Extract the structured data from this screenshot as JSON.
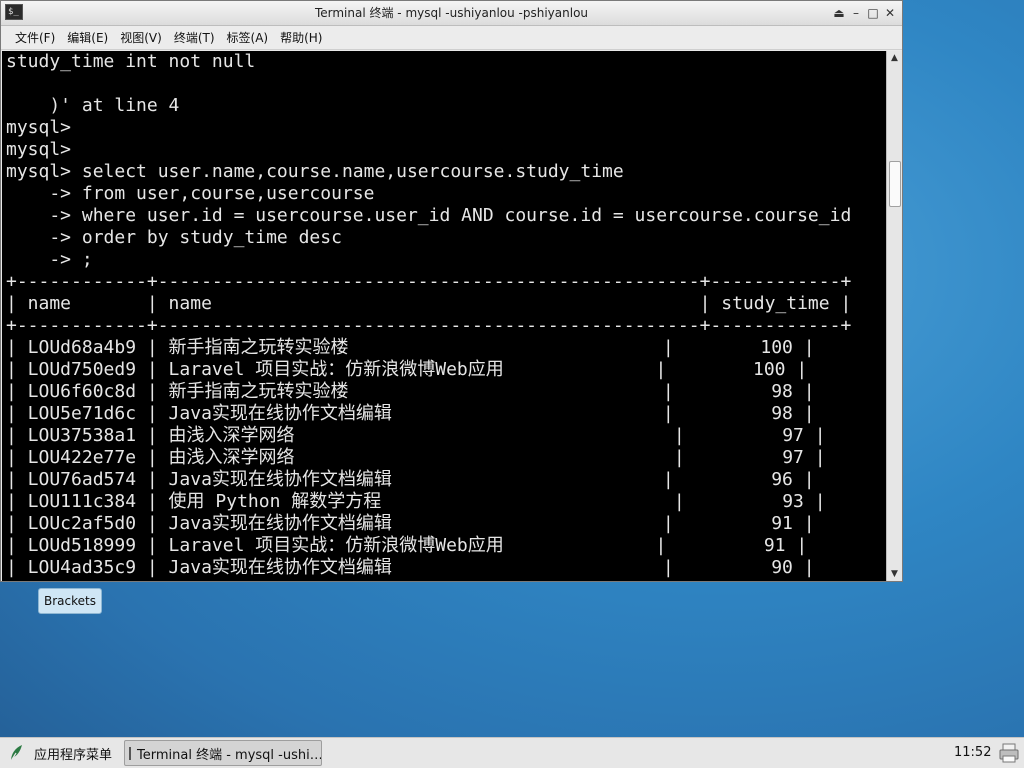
{
  "window": {
    "title": "Terminal 终端 - mysql -ushiyanlou -pshiyanlou",
    "icon_glyph": "$_",
    "controls": [
      "⏏",
      "–",
      "□",
      "✕"
    ]
  },
  "menubar": {
    "items": [
      "文件(F)",
      "编辑(E)",
      "视图(V)",
      "终端(T)",
      "标签(A)",
      "帮助(H)"
    ]
  },
  "terminal": {
    "lines": [
      "study_time int not null",
      "",
      "    )' at line 4",
      "mysql>",
      "mysql>",
      "mysql> select user.name,course.name,usercourse.study_time",
      "    -> from user,course,usercourse",
      "    -> where user.id = usercourse.user_id AND course.id = usercourse.course_id",
      "    -> order by study_time desc",
      "    -> ;",
      "+------------+--------------------------------------------------+------------+",
      "| name       | name                                             | study_time |",
      "+------------+--------------------------------------------------+------------+",
      "| LOUd68a4b9 | 新手指南之玩转实验楼                             |        100 |",
      "| LOUd750ed9 | Laravel 项目实战：仿新浪微博Web应用              |        100 |",
      "| LOU6f60c8d | 新手指南之玩转实验楼                             |         98 |",
      "| LOU5e71d6c | Java实现在线协作文档编辑                         |         98 |",
      "| LOU37538a1 | 由浅入深学网络                                   |         97 |",
      "| LOU422e77e | 由浅入深学网络                                   |         97 |",
      "| LOU76ad574 | Java实现在线协作文档编辑                         |         96 |",
      "| LOU111c384 | 使用 Python 解数学方程                           |         93 |",
      "| LOUc2af5d0 | Java实现在线协作文档编辑                         |         91 |",
      "| LOUd518999 | Laravel 项目实战：仿新浪微博Web应用              |         91 |",
      "| LOU4ad35c9 | Java实现在线协作文档编辑                         |         90 |"
    ]
  },
  "scrollbar": {
    "up": "▲",
    "down": "▼"
  },
  "tooltip": {
    "text": "Brackets"
  },
  "taskbar": {
    "apps_menu": "应用程序菜单",
    "task": "Terminal 终端 - mysql -ushi…",
    "clock": "11:52"
  },
  "colors": {
    "terminal_bg": "#000000",
    "terminal_fg": "#e6e6e6",
    "desktop": "#2f86c4"
  }
}
